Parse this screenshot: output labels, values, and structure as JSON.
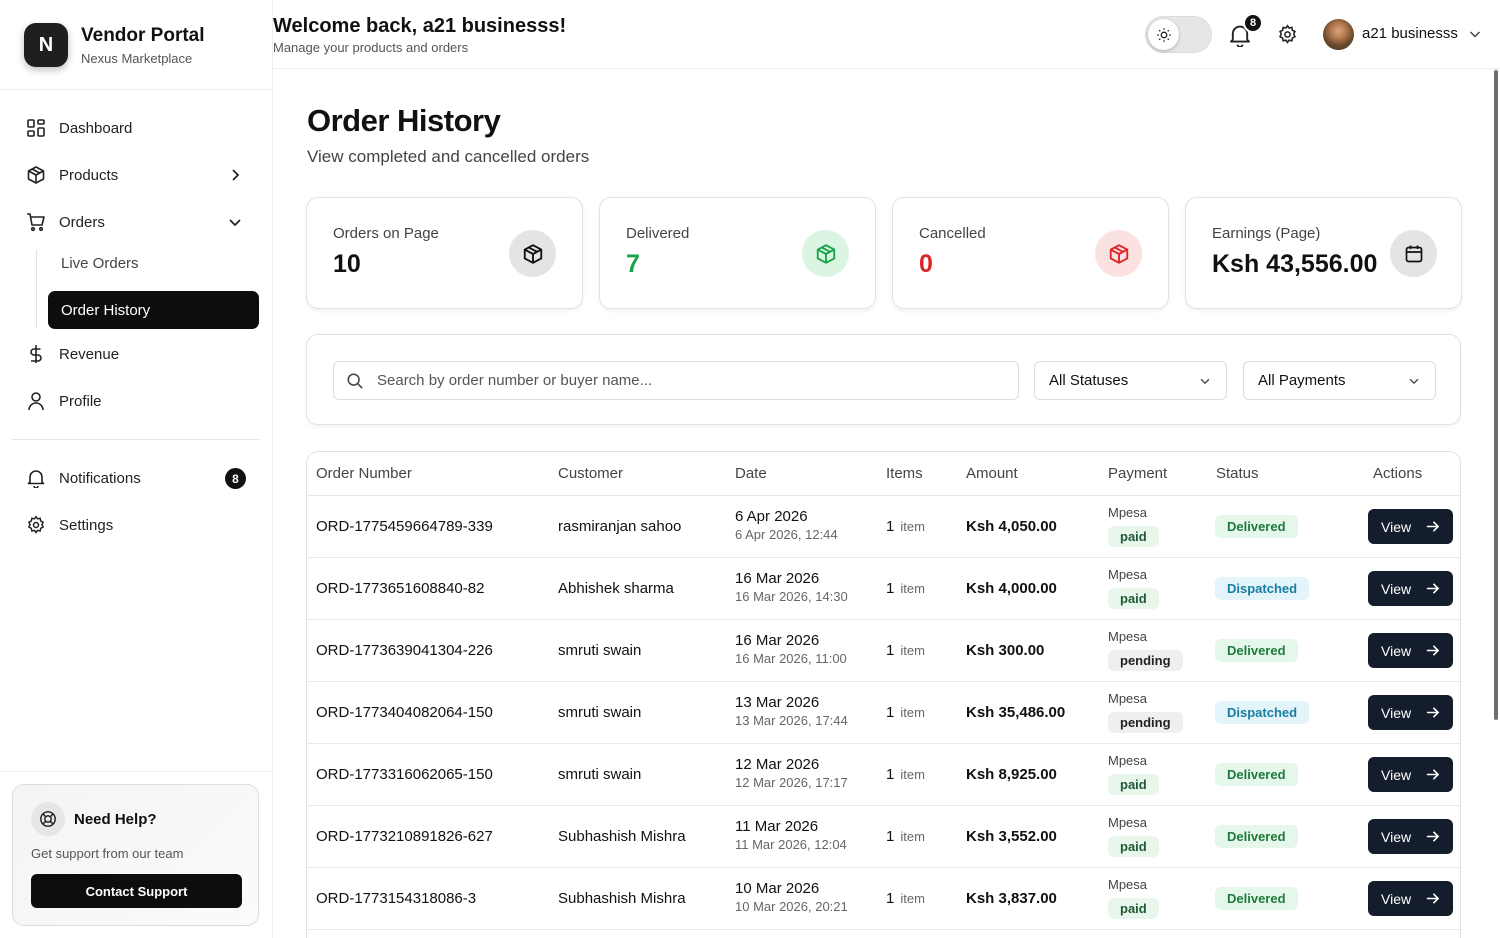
{
  "brand": {
    "logo_letter": "N",
    "title": "Vendor Portal",
    "subtitle": "Nexus Marketplace"
  },
  "sidebar": {
    "items": [
      {
        "label": "Dashboard",
        "icon": "grid-icon"
      },
      {
        "label": "Products",
        "icon": "box-icon"
      },
      {
        "label": "Orders",
        "icon": "cart-icon"
      },
      {
        "label": "Revenue",
        "icon": "dollar-icon"
      },
      {
        "label": "Profile",
        "icon": "user-icon"
      },
      {
        "label": "Notifications",
        "icon": "bell-icon",
        "badge": "8"
      },
      {
        "label": "Settings",
        "icon": "gear-icon"
      }
    ],
    "orders_sub": {
      "live": "Live Orders",
      "history": "Order History"
    },
    "help": {
      "title": "Need Help?",
      "subtitle": "Get support from our team",
      "button": "Contact Support"
    }
  },
  "header": {
    "welcome": "Welcome back, a21 businesss!",
    "subtitle": "Manage your products and orders",
    "notification_count": "8",
    "user_name": "a21 businesss"
  },
  "page": {
    "title": "Order History",
    "subtitle": "View completed and cancelled orders"
  },
  "stats": [
    {
      "label": "Orders on Page",
      "value": "10",
      "color": "#111111"
    },
    {
      "label": "Delivered",
      "value": "7",
      "color": "#16a34a"
    },
    {
      "label": "Cancelled",
      "value": "0",
      "color": "#dc2626"
    },
    {
      "label": "Earnings (Page)",
      "value": "Ksh 43,556.00",
      "color": "#111111"
    }
  ],
  "filters": {
    "search_placeholder": "Search by order number or buyer name...",
    "status": "All Statuses",
    "payment": "All Payments"
  },
  "table": {
    "columns": [
      "Order Number",
      "Customer",
      "Date",
      "Items",
      "Amount",
      "Payment",
      "Status",
      "Actions"
    ],
    "view_label": "View",
    "rows": [
      {
        "order": "ORD-1775459664789-339",
        "customer": "rasmiranjan sahoo",
        "date": "6 Apr 2026",
        "datetime": "6 Apr 2026, 12:44",
        "items": "1",
        "unit": "item",
        "amount": "Ksh 4,050.00",
        "method": "Mpesa",
        "payment": "paid",
        "status": "Delivered"
      },
      {
        "order": "ORD-1773651608840-82",
        "customer": "Abhishek sharma",
        "date": "16 Mar 2026",
        "datetime": "16 Mar 2026, 14:30",
        "items": "1",
        "unit": "item",
        "amount": "Ksh 4,000.00",
        "method": "Mpesa",
        "payment": "paid",
        "status": "Dispatched"
      },
      {
        "order": "ORD-1773639041304-226",
        "customer": "smruti swain",
        "date": "16 Mar 2026",
        "datetime": "16 Mar 2026, 11:00",
        "items": "1",
        "unit": "item",
        "amount": "Ksh 300.00",
        "method": "Mpesa",
        "payment": "pending",
        "status": "Delivered"
      },
      {
        "order": "ORD-1773404082064-150",
        "customer": "smruti swain",
        "date": "13 Mar 2026",
        "datetime": "13 Mar 2026, 17:44",
        "items": "1",
        "unit": "item",
        "amount": "Ksh 35,486.00",
        "method": "Mpesa",
        "payment": "pending",
        "status": "Dispatched"
      },
      {
        "order": "ORD-1773316062065-150",
        "customer": "smruti swain",
        "date": "12 Mar 2026",
        "datetime": "12 Mar 2026, 17:17",
        "items": "1",
        "unit": "item",
        "amount": "Ksh 8,925.00",
        "method": "Mpesa",
        "payment": "paid",
        "status": "Delivered"
      },
      {
        "order": "ORD-1773210891826-627",
        "customer": "Subhashish Mishra",
        "date": "11 Mar 2026",
        "datetime": "11 Mar 2026, 12:04",
        "items": "1",
        "unit": "item",
        "amount": "Ksh 3,552.00",
        "method": "Mpesa",
        "payment": "paid",
        "status": "Delivered"
      },
      {
        "order": "ORD-1773154318086-3",
        "customer": "Subhashish Mishra",
        "date": "10 Mar 2026",
        "datetime": "10 Mar 2026, 20:21",
        "items": "1",
        "unit": "item",
        "amount": "Ksh 3,837.00",
        "method": "Mpesa",
        "payment": "paid",
        "status": "Delivered"
      }
    ]
  }
}
